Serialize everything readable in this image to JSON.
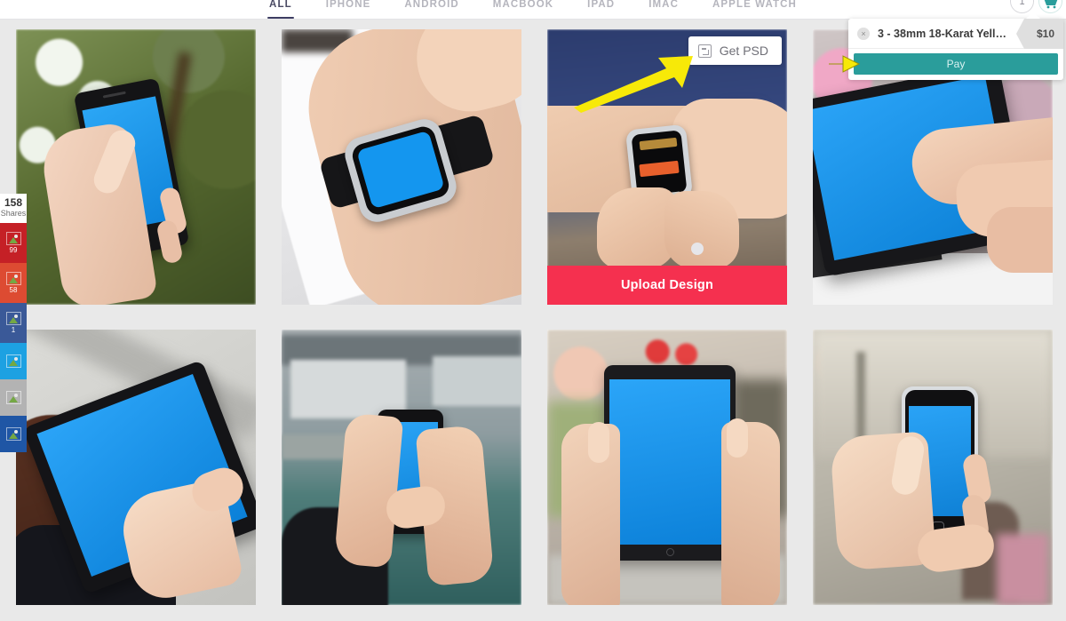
{
  "nav": {
    "tabs": [
      {
        "label": "ALL",
        "active": true
      },
      {
        "label": "IPHONE",
        "active": false
      },
      {
        "label": "ANDROID",
        "active": false
      },
      {
        "label": "MACBOOK",
        "active": false
      },
      {
        "label": "IPAD",
        "active": false
      },
      {
        "label": "IMAC",
        "active": false
      },
      {
        "label": "APPLE WATCH",
        "active": false
      }
    ],
    "cart_count": "1",
    "cart_icon": "shopping-cart-icon"
  },
  "checkout": {
    "remove_label": "×",
    "item_title": "3 - 38mm 18-Karat Yell…",
    "item_price": "$10",
    "pay_label": "Pay",
    "accent_color": "#2a9d9b"
  },
  "share": {
    "count": "158",
    "count_label": "Shares",
    "buttons": [
      {
        "name": "share-pinterest",
        "color": "#c52026",
        "count": "99",
        "icon": "broken-image-icon"
      },
      {
        "name": "share-google-plus",
        "color": "#dd4b32",
        "count": "58",
        "icon": "broken-image-icon"
      },
      {
        "name": "share-facebook",
        "color": "#3a5998",
        "count": "1",
        "icon": "broken-image-icon"
      },
      {
        "name": "share-twitter",
        "color": "#1da1e2",
        "count": "",
        "icon": "broken-image-icon"
      },
      {
        "name": "share-disabled",
        "color": "#b3b3b3",
        "count": "",
        "icon": "broken-image-icon"
      },
      {
        "name": "share-linkedin",
        "color": "#1f56a5",
        "count": "",
        "icon": "broken-image-icon"
      }
    ]
  },
  "grid": {
    "cards": [
      {
        "name": "mockup-card-android-phone-foliage",
        "device": "phone-landscape-tilt",
        "alt": "Hand holding black Android phone with blue screen in front of green leafy tree",
        "hovered": false
      },
      {
        "name": "mockup-card-apple-watch-desk",
        "device": "watch",
        "alt": "Apple Watch with black band on wrist over white paper desk, blue screen",
        "hovered": false
      },
      {
        "name": "mockup-card-apple-watch-outdoors",
        "device": "watch-small",
        "alt": "Silver Apple Watch on wrist being touched, blue navy background",
        "hovered": true
      },
      {
        "name": "mockup-card-ipad-street-tap",
        "device": "tablet-tilt",
        "alt": "Hand tapping iPad with blue screen on busy street",
        "hovered": false
      },
      {
        "name": "mockup-card-tablet-overhead",
        "device": "tablet-overhead",
        "alt": "Overhead view of woman holding tablet with blue screen on pavement",
        "hovered": false
      },
      {
        "name": "mockup-card-phone-harbor",
        "device": "phone-portrait",
        "alt": "Two hands holding smartphone with blue screen at a harbor",
        "hovered": false
      },
      {
        "name": "mockup-card-ipad-portrait-street",
        "device": "tablet-portrait",
        "alt": "Two hands holding iPad portrait with blue screen on a street",
        "hovered": false
      },
      {
        "name": "mockup-card-iphone-city",
        "device": "phone-portrait-city",
        "alt": "Hand holding iPhone with blue screen in a blurred city street",
        "hovered": false
      }
    ],
    "hover_card": {
      "get_psd_label": "Get PSD",
      "get_psd_icon": "photoshop-icon",
      "upload_label": "Upload Design",
      "upload_color": "#f5304f"
    },
    "annotations": [
      {
        "name": "arrow-to-get-psd",
        "color": "#f7e908"
      },
      {
        "name": "arrow-to-pay",
        "color": "#f7e908"
      }
    ]
  }
}
